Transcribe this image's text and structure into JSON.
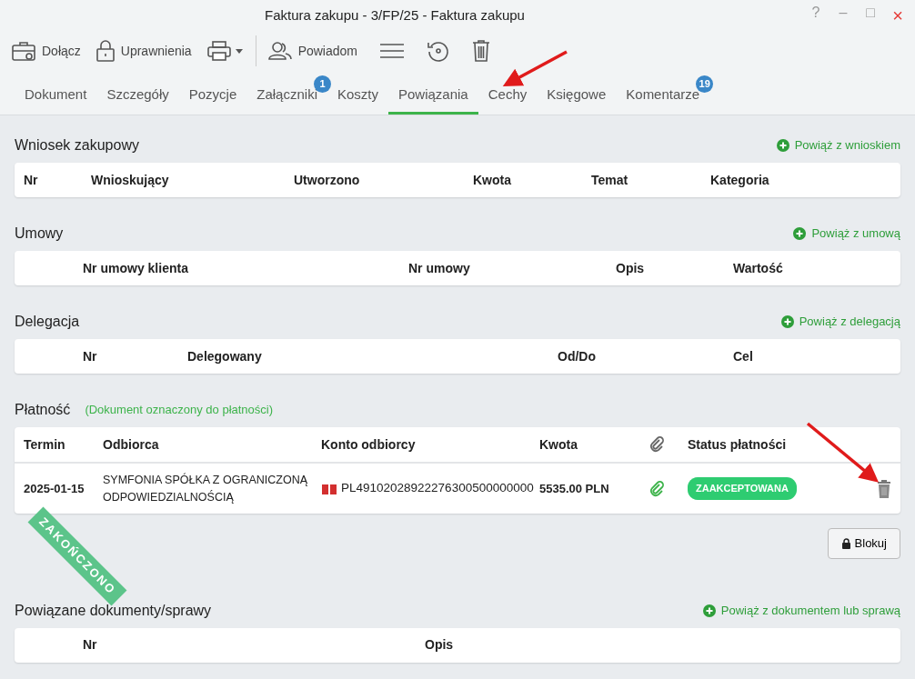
{
  "window": {
    "title": "Faktura zakupu - 3/FP/25 - Faktura zakupu",
    "controls": [
      "?",
      "–",
      "□",
      "×"
    ]
  },
  "toolbar": [
    {
      "kind": "attach",
      "label": "Dołącz"
    },
    {
      "kind": "lock",
      "label": "Uprawnienia"
    },
    {
      "kind": "print"
    },
    {
      "kind": "notify",
      "label": "Powiadom"
    },
    {
      "kind": "menu"
    },
    {
      "kind": "history"
    },
    {
      "kind": "delete"
    }
  ],
  "tabs": [
    {
      "label": "Dokument",
      "selected": false
    },
    {
      "label": "Szczegóły",
      "selected": false
    },
    {
      "label": "Pozycje",
      "selected": false
    },
    {
      "label": "Załączniki",
      "selected": false,
      "badge": "1"
    },
    {
      "label": "Koszty",
      "selected": false
    },
    {
      "label": "Powiązania",
      "selected": true
    },
    {
      "label": "Cechy",
      "selected": false
    },
    {
      "label": "Księgowe",
      "selected": false
    },
    {
      "label": "Komentarze",
      "selected": false,
      "badge": "19"
    }
  ],
  "sections": [
    {
      "title": "Wniosek zakupowy",
      "link": "Powiąż z wnioskiem",
      "columns": [
        "Nr",
        "Wnioskujący",
        "Utworzono",
        "Kwota",
        "Temat",
        "Kategoria"
      ]
    },
    {
      "title": "Umowy",
      "link": "Powiąż z umową",
      "columns": [
        "",
        "Nr umowy klienta",
        "Nr umowy",
        "Opis",
        "Wartość"
      ]
    },
    {
      "title": "Delegacja",
      "link": "Powiąż z delegacją",
      "columns": [
        "",
        "Nr",
        "Delegowany",
        "Od/Do",
        "Cel"
      ]
    },
    {
      "title": "Płatność",
      "note": "(Dokument oznaczony do płatności)",
      "columns": [
        "Termin",
        "Odbiorca",
        "Konto odbiorcy",
        "Kwota",
        "",
        "Status płatności",
        ""
      ],
      "rows": [
        {
          "termin": "2025-01-15",
          "odbiorca": "SYMFONIA SPÓŁKA Z OGRANICZONĄ ODPOWIEDZIALNOŚCIĄ",
          "konto": "PL49102028922276300500000000",
          "kwota": "5535.00 PLN",
          "status": "ZAAKCEPTOWANA"
        }
      ],
      "button": "Blokuj"
    },
    {
      "title": "Powiązane dokumenty/sprawy",
      "link": "Powiąż z dokumentem lub sprawą",
      "columns": [
        "",
        "Nr",
        "Opis"
      ]
    }
  ],
  "status_ribbon": "ZAKOŃCZONO"
}
